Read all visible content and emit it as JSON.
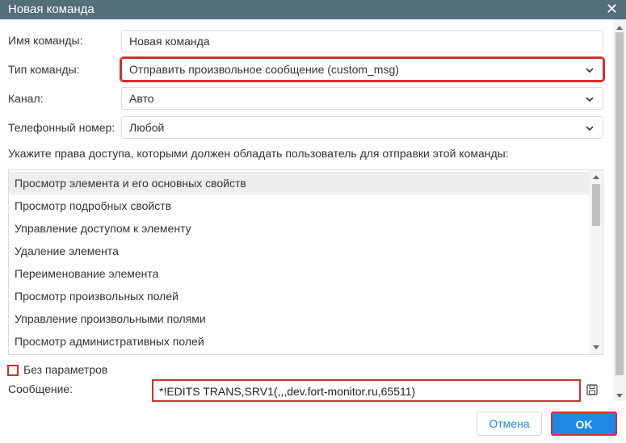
{
  "dialog": {
    "title": "Новая команда",
    "close_glyph": "✕"
  },
  "form": {
    "name": {
      "label": "Имя команды:",
      "value": "Новая команда"
    },
    "type": {
      "label": "Тип команды:",
      "value": "Отправить произвольное сообщение (custom_msg)"
    },
    "channel": {
      "label": "Канал:",
      "value": "Авто"
    },
    "phone": {
      "label": "Телефонный номер:",
      "value": "Любой"
    }
  },
  "rights": {
    "hint": "Укажите права доступа, которыми должен обладать пользователь для отправки этой команды:",
    "items": [
      "Просмотр элемента и его основных свойств",
      "Просмотр подробных свойств",
      "Управление доступом к элементу",
      "Удаление элемента",
      "Переименование элемента",
      "Просмотр произвольных полей",
      "Управление произвольными полями",
      "Просмотр административных полей"
    ]
  },
  "no_params": {
    "label": "Без параметров",
    "checked": false
  },
  "message": {
    "label": "Сообщение:",
    "value": "*!EDITS TRANS,SRV1(,,,dev.fort-monitor.ru,65511)"
  },
  "buttons": {
    "cancel": "Отмена",
    "ok": "OK"
  },
  "colors": {
    "titlebar": "#546e7a",
    "accent": "#1e88e5",
    "highlight": "#d32f2f"
  },
  "icons": [
    "close-icon",
    "chevron-down-icon",
    "save-icon"
  ]
}
